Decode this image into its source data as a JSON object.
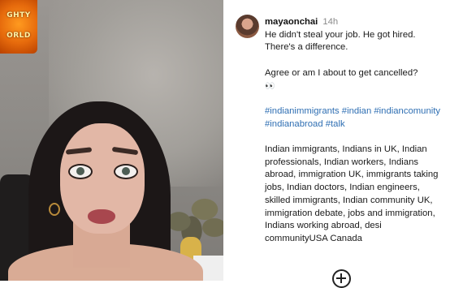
{
  "logo": {
    "line1": "GHTY",
    "line2": "ORLD"
  },
  "post": {
    "username": "mayaonchai",
    "time": "14h",
    "caption_line1": "He didn't steal your job. He got hired. There's a difference.",
    "caption_line2": "Agree or am I about to get cancelled?",
    "caption_emoji": "👀",
    "hashtags": "#indianimmigrants #indian #indiancomunity #indianabroad #talk",
    "keywords": "Indian immigrants, Indians in UK, Indian professionals, Indian workers, Indians abroad, immigration UK, immigrants taking jobs, Indian doctors, Indian engineers, skilled immigrants, Indian community UK, immigration debate, jobs and immigration, Indians working abroad, desi communityUSA Canada"
  },
  "icons": {
    "add": "add-circle-icon",
    "avatar": "profile-avatar"
  },
  "colors": {
    "hashtag": "#2f6fb3",
    "timestamp": "#8a8a8a",
    "logo_orange": "#e66a0c"
  }
}
